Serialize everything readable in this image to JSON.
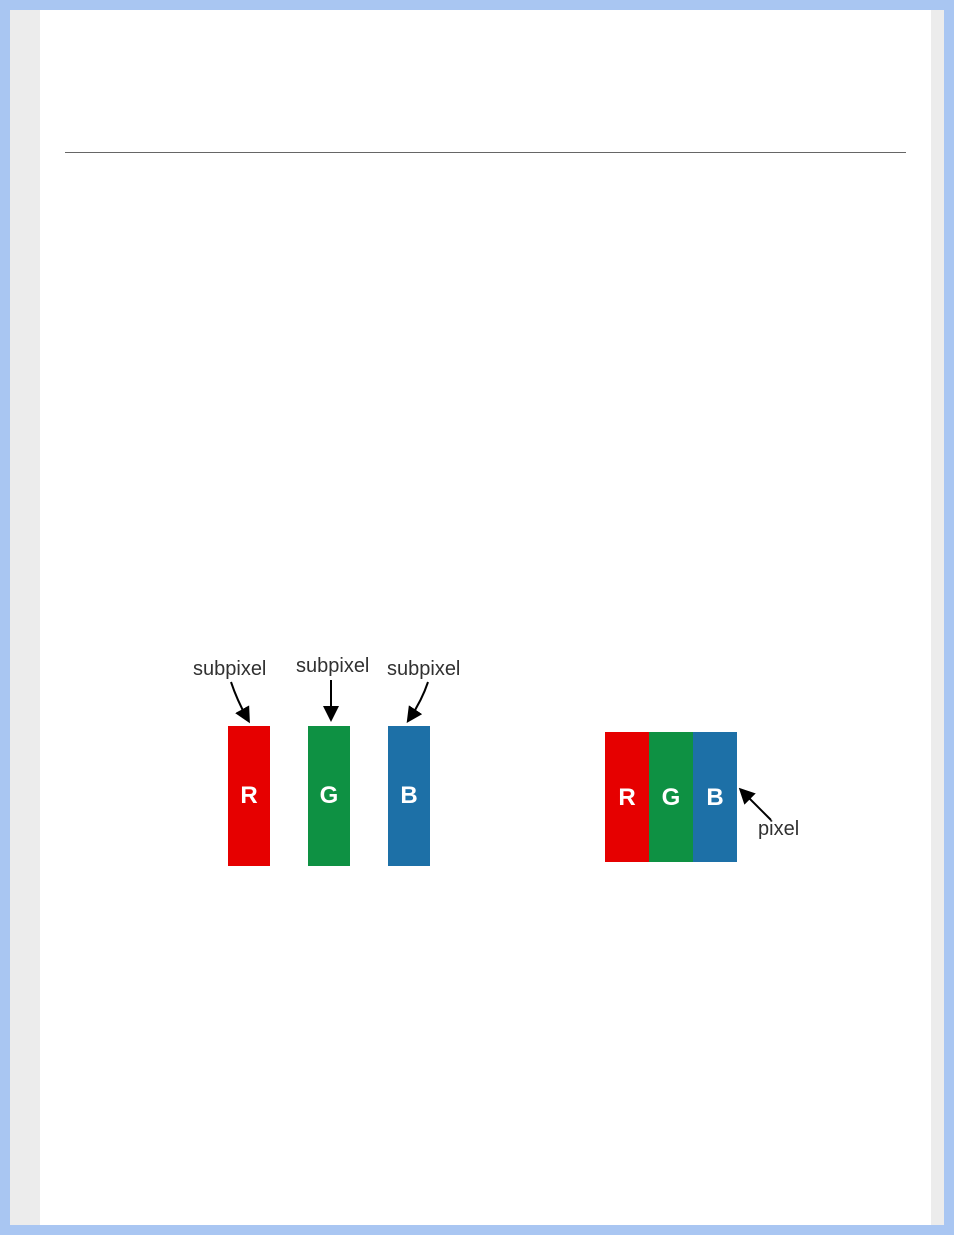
{
  "labels": {
    "subpixel1": "subpixel",
    "subpixel2": "subpixel",
    "subpixel3": "subpixel",
    "pixel": "pixel"
  },
  "bars": {
    "left": {
      "R": "R",
      "G": "G",
      "B": "B"
    },
    "right": {
      "R": "R",
      "G": "G",
      "B": "B"
    }
  },
  "colors": {
    "red": "#e60000",
    "green": "#0e9143",
    "blue": "#1d70a7"
  }
}
